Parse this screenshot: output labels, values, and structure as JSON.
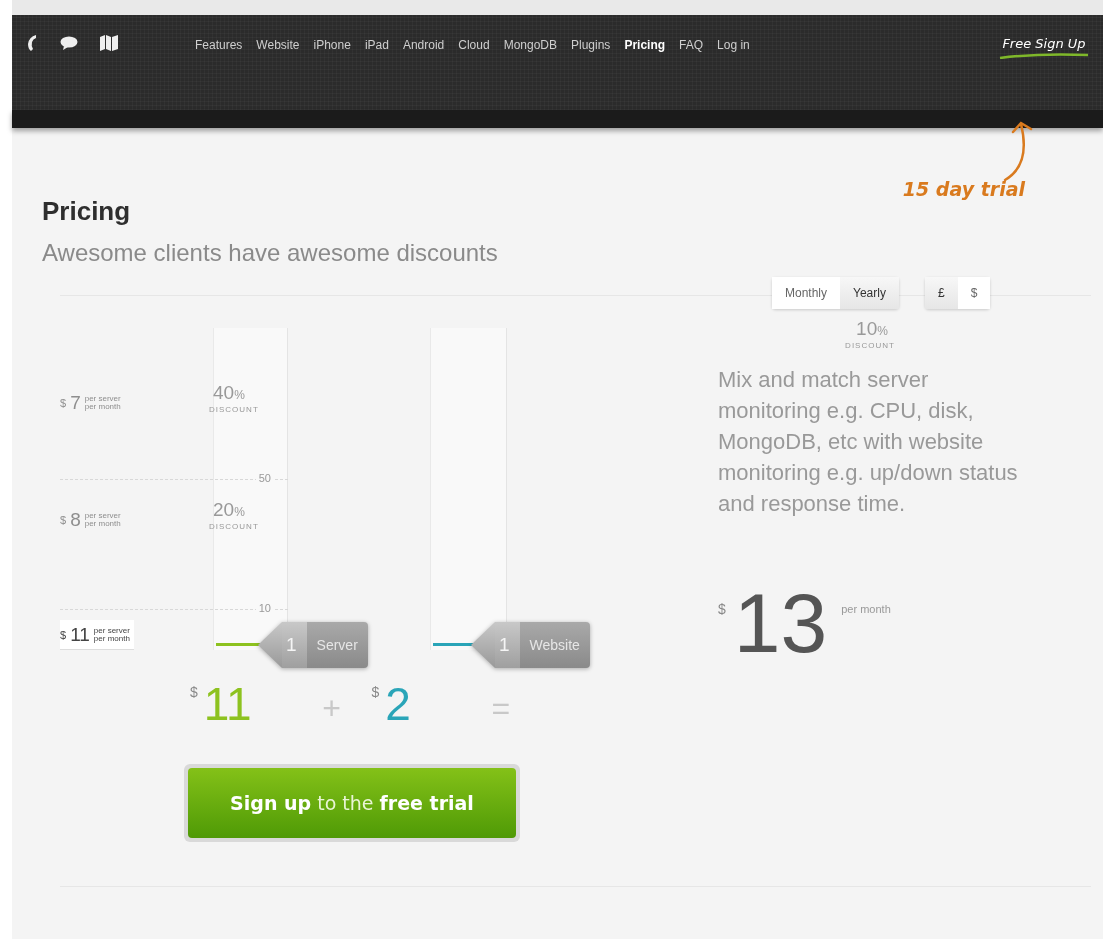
{
  "nav": {
    "links": [
      {
        "label": "Features",
        "selected": false
      },
      {
        "label": "Website",
        "selected": false
      },
      {
        "label": "iPhone",
        "selected": false
      },
      {
        "label": "iPad",
        "selected": false
      },
      {
        "label": "Android",
        "selected": false
      },
      {
        "label": "Cloud",
        "selected": false
      },
      {
        "label": "MongoDB",
        "selected": false
      },
      {
        "label": "Plugins",
        "selected": false
      },
      {
        "label": "Pricing",
        "selected": true
      },
      {
        "label": "FAQ",
        "selected": false
      },
      {
        "label": "Log in",
        "selected": false
      }
    ],
    "signup": "Free Sign Up",
    "annotation": "15 day trial"
  },
  "heading": "Pricing",
  "subheading": "Awesome clients have awesome discounts",
  "billing": [
    {
      "label": "Monthly",
      "selected": false
    },
    {
      "label": "Yearly",
      "selected": true
    }
  ],
  "currency": [
    {
      "label": "£",
      "selected": true
    },
    {
      "label": "$",
      "selected": false
    }
  ],
  "yearly_discount": {
    "value": "10",
    "unit": "%",
    "label": "DISCOUNT"
  },
  "tiers": [
    {
      "currency": "$",
      "price": "7",
      "unit_top": "per server",
      "unit_bottom": "per month",
      "discount": "40",
      "discount_unit": "%",
      "discount_label": "DISCOUNT",
      "selected": false
    },
    {
      "currency": "$",
      "price": "8",
      "unit_top": "per server",
      "unit_bottom": "per month",
      "discount": "20",
      "discount_unit": "%",
      "discount_label": "DISCOUNT",
      "selected": false
    },
    {
      "currency": "$",
      "price": "11",
      "unit_top": "per server",
      "unit_bottom": "per month",
      "selected": true
    }
  ],
  "server_scale": [
    "50",
    "10"
  ],
  "sliders": [
    {
      "count": "1",
      "label": "Server",
      "color": "#8dc21f"
    },
    {
      "count": "1",
      "label": "Website",
      "color": "#2aa5b8"
    }
  ],
  "subtotals": [
    {
      "currency": "$",
      "amount": "11"
    },
    {
      "currency": "$",
      "amount": "2"
    }
  ],
  "operators": [
    "+",
    "="
  ],
  "description": "Mix and match server monitoring e.g. CPU, disk, MongoDB, etc with website monitoring e.g. up/down status and response time.",
  "total": {
    "currency": "$",
    "amount": "13",
    "period": "per month"
  },
  "cta": "**Sign up** to the **free trial**"
}
